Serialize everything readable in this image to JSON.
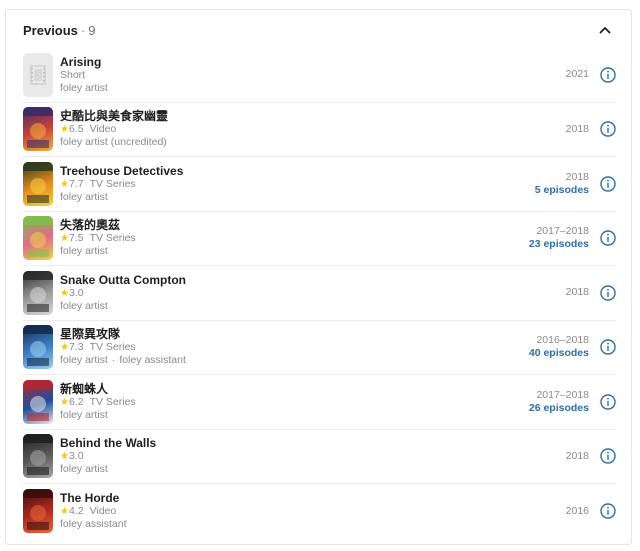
{
  "section": {
    "title": "Previous",
    "separator": "·",
    "count": "9"
  },
  "colors": {
    "accent": "#2f6ea5",
    "star": "#f5c518",
    "muted": "#8a8a8a"
  },
  "items": [
    {
      "title": "Arising",
      "rating": "",
      "type": "Short",
      "role": "foley artist",
      "role2": "",
      "year": "2021",
      "episodes": "",
      "poster": "placeholder",
      "poster_colors": [
        "#e9e9e9",
        "#d5d5d5"
      ]
    },
    {
      "title": "史酷比與美食家幽靈",
      "rating": "6.5",
      "type": "Video",
      "role": "foley artist (uncredited)",
      "role2": "",
      "year": "2018",
      "episodes": "",
      "poster": "image",
      "poster_colors": [
        "#3a2a66",
        "#c8423c",
        "#f0b23a"
      ]
    },
    {
      "title": "Treehouse Detectives",
      "rating": "7.7",
      "type": "TV Series",
      "role": "foley artist",
      "role2": "",
      "year": "2018",
      "episodes": "5 episodes",
      "poster": "image",
      "poster_colors": [
        "#2b3a1c",
        "#e58b1e",
        "#f4d03f"
      ]
    },
    {
      "title": "失落的奧茲",
      "rating": "7.5",
      "type": "TV Series",
      "role": "foley artist",
      "role2": "",
      "year": "2017–2018",
      "episodes": "23 episodes",
      "poster": "image",
      "poster_colors": [
        "#7fbf4a",
        "#e06c8a",
        "#f0d24b"
      ]
    },
    {
      "title": "Snake Outta Compton",
      "rating": "3.0",
      "type": "",
      "role": "foley artist",
      "role2": "",
      "year": "2018",
      "episodes": "",
      "poster": "image",
      "poster_colors": [
        "#2a2a2a",
        "#9b9b9b",
        "#d9d9d9"
      ]
    },
    {
      "title": "星際異攻隊",
      "rating": "7.3",
      "type": "TV Series",
      "role": "foley artist",
      "role2": "foley assistant",
      "year": "2016–2018",
      "episodes": "40 episodes",
      "poster": "image",
      "poster_colors": [
        "#14294d",
        "#3d7fc4",
        "#9fd0f0"
      ]
    },
    {
      "title": "新蜘蛛人",
      "rating": "6.2",
      "type": "TV Series",
      "role": "foley artist",
      "role2": "",
      "year": "2017–2018",
      "episodes": "26 episodes",
      "poster": "image",
      "poster_colors": [
        "#b5272f",
        "#1f4f9c",
        "#e8e8e8"
      ]
    },
    {
      "title": "Behind the Walls",
      "rating": "3.0",
      "type": "",
      "role": "foley artist",
      "role2": "",
      "year": "2018",
      "episodes": "",
      "poster": "image",
      "poster_colors": [
        "#1e1e1e",
        "#5a5a5a",
        "#a8a8a8"
      ]
    },
    {
      "title": "The Horde",
      "rating": "4.2",
      "type": "Video",
      "role": "foley assistant",
      "role2": "",
      "year": "2016",
      "episodes": "",
      "poster": "image",
      "poster_colors": [
        "#3a0d0d",
        "#b0281e",
        "#e86a3a"
      ]
    }
  ]
}
